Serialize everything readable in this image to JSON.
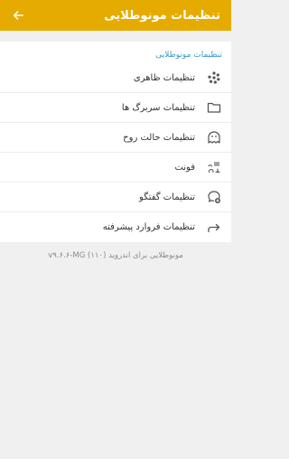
{
  "header": {
    "title": "تنظیمات مونوطلایی",
    "back_icon": "arrow-back-icon",
    "background": "#e6ab00"
  },
  "section": {
    "title": "تنظیمات مونوطلایی",
    "title_color": "#3a96c8"
  },
  "items": [
    {
      "label": "تنظیمات ظاهری",
      "icon": "palette-icon"
    },
    {
      "label": "تنظیمات سربرگ ها",
      "icon": "folder-icon"
    },
    {
      "label": "تنظیمات حالت روح",
      "icon": "ghost-icon"
    },
    {
      "label": "فونت",
      "icon": "font-icon"
    },
    {
      "label": "تنظیمات گفتگو",
      "icon": "chat-add-icon"
    },
    {
      "label": "تنظیمات فروارد پیشرفته",
      "icon": "forward-icon"
    }
  ],
  "footer": {
    "version_text": "مونوطلایی برای اندروید (۱۱۰) v۹.۶.۶-MG"
  }
}
